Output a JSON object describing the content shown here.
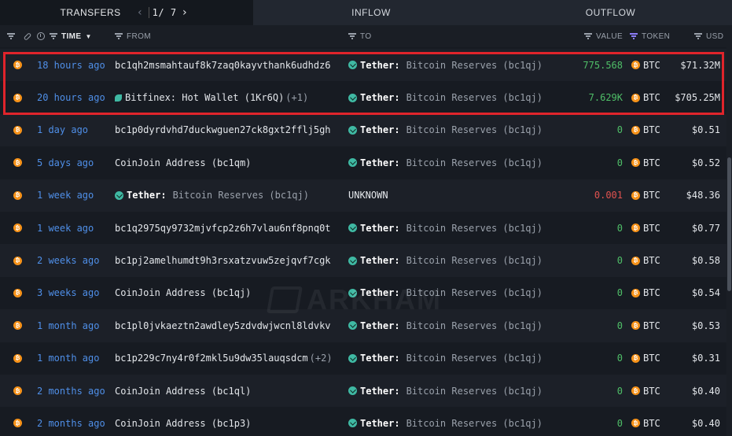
{
  "tabs": {
    "transfers": "TRANSFERS",
    "page": "1/ 7",
    "inflow": "INFLOW",
    "outflow": "OUTFLOW"
  },
  "columns": {
    "time": "TIME",
    "from": "FROM",
    "to": "TO",
    "value": "VALUE",
    "token": "TOKEN",
    "usd": "USD"
  },
  "watermark": "ARKHAM",
  "rows": [
    {
      "time": "18 hours ago",
      "from": {
        "type": "address",
        "text": "bc1qh2msmahtauf8k7zaq0kayvthank6udhdz6",
        "extra": ""
      },
      "to": {
        "type": "entity",
        "name": "Tether:",
        "sub": "Bitcoin Reserves (bc1qj)"
      },
      "value": "775.568",
      "value_color": "green",
      "token": "BTC",
      "usd": "$71.32M"
    },
    {
      "time": "20 hours ago",
      "from": {
        "type": "entity-bfx",
        "name": "Bitfinex: Hot Wallet (1Kr6Q)",
        "sub": "",
        "extra": "(+1)"
      },
      "to": {
        "type": "entity",
        "name": "Tether:",
        "sub": "Bitcoin Reserves (bc1qj)"
      },
      "value": "7.629K",
      "value_color": "green",
      "token": "BTC",
      "usd": "$705.25M"
    },
    {
      "time": "1 day ago",
      "from": {
        "type": "address",
        "text": "bc1p0dyrdvhd7duckwguen27ck8gxt2fflj5gh",
        "extra": ""
      },
      "to": {
        "type": "entity",
        "name": "Tether:",
        "sub": "Bitcoin Reserves (bc1qj)"
      },
      "value": "0",
      "value_color": "green",
      "token": "BTC",
      "usd": "$0.51"
    },
    {
      "time": "5 days ago",
      "from": {
        "type": "address",
        "text": "CoinJoin Address (bc1qm)",
        "extra": ""
      },
      "to": {
        "type": "entity",
        "name": "Tether:",
        "sub": "Bitcoin Reserves (bc1qj)"
      },
      "value": "0",
      "value_color": "green",
      "token": "BTC",
      "usd": "$0.52"
    },
    {
      "time": "1 week ago",
      "from": {
        "type": "entity",
        "name": "Tether:",
        "sub": "Bitcoin Reserves (bc1qj)",
        "extra": ""
      },
      "to": {
        "type": "unknown",
        "name": "UNKNOWN",
        "sub": ""
      },
      "value": "0.001",
      "value_color": "red",
      "token": "BTC",
      "usd": "$48.36"
    },
    {
      "time": "1 week ago",
      "from": {
        "type": "address",
        "text": "bc1q2975qy9732mjvfcp2z6h7vlau6nf8pnq0t",
        "extra": ""
      },
      "to": {
        "type": "entity",
        "name": "Tether:",
        "sub": "Bitcoin Reserves (bc1qj)"
      },
      "value": "0",
      "value_color": "green",
      "token": "BTC",
      "usd": "$0.77"
    },
    {
      "time": "2 weeks ago",
      "from": {
        "type": "address",
        "text": "bc1pj2amelhumdt9h3rsxatzvuw5zejqvf7cgk",
        "extra": ""
      },
      "to": {
        "type": "entity",
        "name": "Tether:",
        "sub": "Bitcoin Reserves (bc1qj)"
      },
      "value": "0",
      "value_color": "green",
      "token": "BTC",
      "usd": "$0.58"
    },
    {
      "time": "3 weeks ago",
      "from": {
        "type": "address",
        "text": "CoinJoin Address (bc1qj)",
        "extra": ""
      },
      "to": {
        "type": "entity",
        "name": "Tether:",
        "sub": "Bitcoin Reserves (bc1qj)"
      },
      "value": "0",
      "value_color": "green",
      "token": "BTC",
      "usd": "$0.54"
    },
    {
      "time": "1 month ago",
      "from": {
        "type": "address",
        "text": "bc1pl0jvkaeztn2awdley5zdvdwjwcnl8ldvkv",
        "extra": ""
      },
      "to": {
        "type": "entity",
        "name": "Tether:",
        "sub": "Bitcoin Reserves (bc1qj)"
      },
      "value": "0",
      "value_color": "green",
      "token": "BTC",
      "usd": "$0.53"
    },
    {
      "time": "1 month ago",
      "from": {
        "type": "address",
        "text": "bc1p229c7ny4r0f2mkl5u9dw35lauqsdcm",
        "extra": "(+2)"
      },
      "to": {
        "type": "entity",
        "name": "Tether:",
        "sub": "Bitcoin Reserves (bc1qj)"
      },
      "value": "0",
      "value_color": "green",
      "token": "BTC",
      "usd": "$0.31"
    },
    {
      "time": "2 months ago",
      "from": {
        "type": "address",
        "text": "CoinJoin Address (bc1ql)",
        "extra": ""
      },
      "to": {
        "type": "entity",
        "name": "Tether:",
        "sub": "Bitcoin Reserves (bc1qj)"
      },
      "value": "0",
      "value_color": "green",
      "token": "BTC",
      "usd": "$0.40"
    },
    {
      "time": "2 months ago",
      "from": {
        "type": "address",
        "text": "CoinJoin Address (bc1p3)",
        "extra": ""
      },
      "to": {
        "type": "entity",
        "name": "Tether:",
        "sub": "Bitcoin Reserves (bc1qj)"
      },
      "value": "0",
      "value_color": "green",
      "token": "BTC",
      "usd": "$0.40"
    }
  ],
  "colors": {
    "time_link": "#4f8fe8",
    "value_green": "#4fbf68",
    "value_red": "#e0524f",
    "btc": "#f7931a",
    "entity_icon": "#3fb9a3",
    "highlight_box": "#e0242b"
  }
}
